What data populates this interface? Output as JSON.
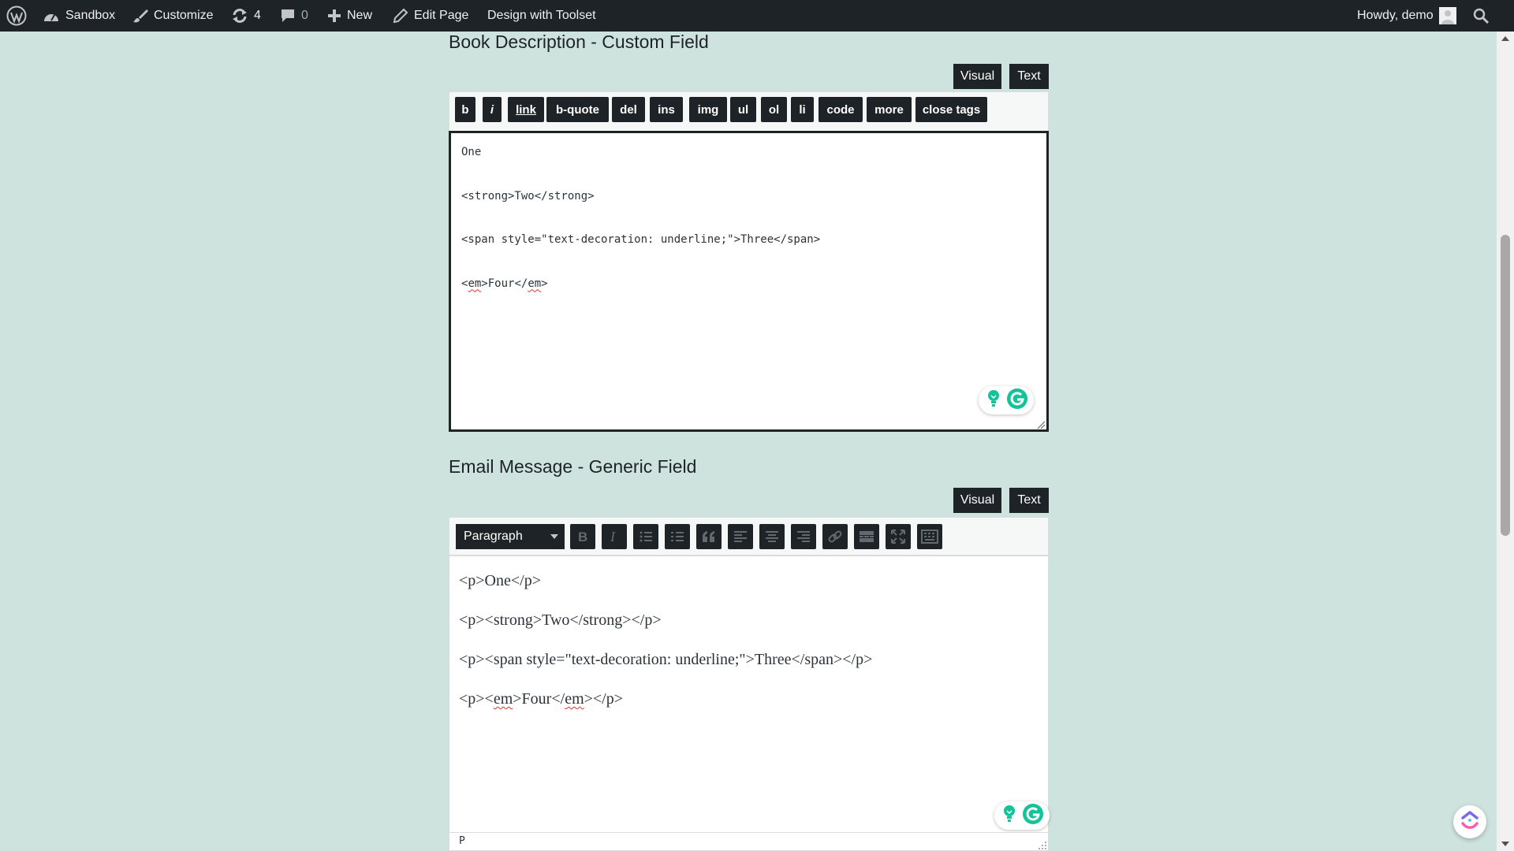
{
  "admin_bar": {
    "site_name": "Sandbox",
    "customize": "Customize",
    "updates_count": "4",
    "comments_count": "0",
    "new": "New",
    "edit_page": "Edit Page",
    "toolset": "Design with Toolset",
    "greeting": "Howdy, demo"
  },
  "book_field": {
    "heading": "Book Description - Custom Field",
    "tab_visual": "Visual",
    "tab_text": "Text",
    "quicktags": [
      "b",
      "i",
      "link",
      "b-quote",
      "del",
      "ins",
      "img",
      "ul",
      "ol",
      "li",
      "code",
      "more",
      "close tags"
    ],
    "lines": [
      "One",
      "<strong>Two</strong>",
      "<span style=\"text-decoration: underline;\">Three</span>",
      {
        "pre": "<",
        "word1": "em",
        "mid": ">Four</",
        "word2": "em",
        "post": ">"
      }
    ]
  },
  "email_field": {
    "heading": "Email Message - Generic Field",
    "tab_visual": "Visual",
    "tab_text": "Text",
    "format_select": "Paragraph",
    "toolbar_icons": [
      "bold-icon",
      "italic-icon",
      "bulleted-list-icon",
      "numbered-list-icon",
      "blockquote-icon",
      "align-left-icon",
      "align-center-icon",
      "align-right-icon",
      "link-icon",
      "read-more-icon",
      "fullscreen-icon",
      "toolbar-toggle-icon"
    ],
    "lines": [
      "<p>One</p>",
      "<p><strong>Two</strong></p>",
      "<p><span style=\"text-decoration: underline;\">Three</span></p>",
      {
        "pre": "<p><",
        "word1": "em",
        "mid": ">Four</",
        "word2": "em",
        "post": "></p>"
      }
    ],
    "status_path": "P"
  },
  "colors": {
    "page_background": "#cfe3de",
    "admin_bar": "#1d2327",
    "grammarly_green": "#15c39a"
  }
}
